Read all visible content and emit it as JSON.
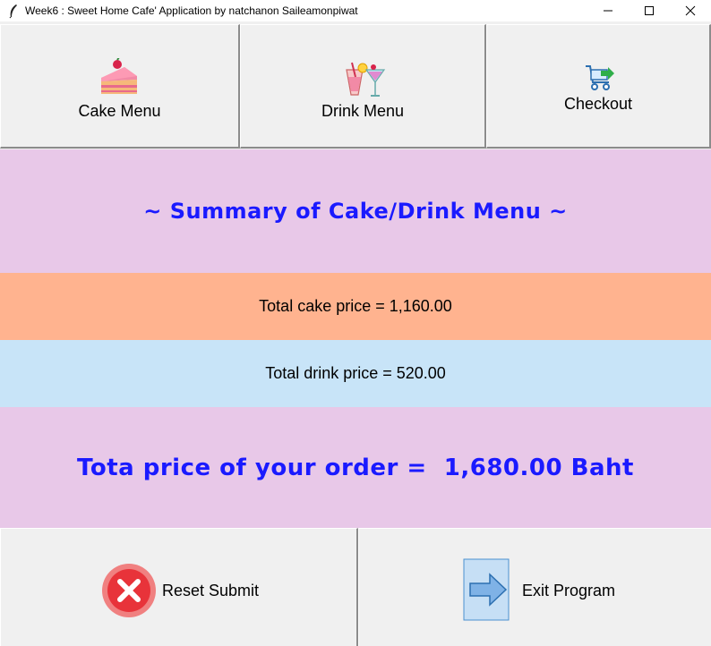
{
  "window": {
    "title": "Week6 : Sweet Home Cafe' Application by natchanon Saileamonpiwat",
    "minimize_icon": "minimize-icon",
    "maximize_icon": "maximize-icon",
    "close_icon": "close-icon"
  },
  "toolbar": {
    "cake_menu_label": "Cake Menu",
    "cake_menu_icon": "cake-icon",
    "drink_menu_label": "Drink Menu",
    "drink_menu_icon": "drinks-icon",
    "checkout_label": "Checkout",
    "checkout_icon": "cart-icon"
  },
  "summary": {
    "heading": "~ Summary of Cake/Drink Menu ~",
    "cake_total": "Total cake price = 1,160.00",
    "drink_total": "Total drink price = 520.00",
    "order_total": "Tota price of your order =  1,680.00 Baht"
  },
  "actions": {
    "reset_label": "Reset Submit",
    "reset_icon": "reset-x-icon",
    "exit_label": "Exit Program",
    "exit_icon": "exit-arrow-icon"
  },
  "colors": {
    "summary_bg": "#e8c8e8",
    "cake_bg": "#ffb38f",
    "drink_bg": "#c8e4f8",
    "accent_text": "#1a1aff"
  }
}
